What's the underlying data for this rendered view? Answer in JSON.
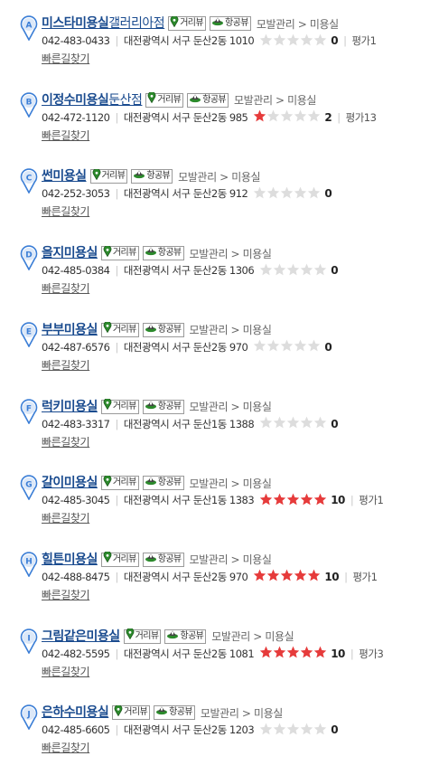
{
  "labels": {
    "street_view": "거리뷰",
    "aerial_view": "항공뷰",
    "category": "모발관리 > 미용실",
    "route": "빠른길찾기",
    "eval_prefix": "평가"
  },
  "colors": {
    "link": "#1a4b8f",
    "star_on": "#e63b3b",
    "star_off": "#dddddd",
    "marker": "#3b7ed6"
  },
  "results": [
    {
      "marker": "A",
      "name_bold": "미스타미용실",
      "name_rest": "갤러리아점",
      "phone": "042-483-0433",
      "address": "대전광역시 서구 둔산2동 1010",
      "rating_stars": 0,
      "score": "0",
      "eval": "1"
    },
    {
      "marker": "B",
      "name_bold": "이정수미용실",
      "name_rest": "둔산점",
      "phone": "042-472-1120",
      "address": "대전광역시 서구 둔산2동 985",
      "rating_stars": 1,
      "score": "2",
      "eval": "13"
    },
    {
      "marker": "C",
      "name_bold": "썬미용실",
      "name_rest": "",
      "phone": "042-252-3053",
      "address": "대전광역시 서구 둔산2동 912",
      "rating_stars": 0,
      "score": "0",
      "eval": ""
    },
    {
      "marker": "D",
      "name_bold": "을지미용실",
      "name_rest": "",
      "phone": "042-485-0384",
      "address": "대전광역시 서구 둔산2동 1306",
      "rating_stars": 0,
      "score": "0",
      "eval": ""
    },
    {
      "marker": "E",
      "name_bold": "부부미용실",
      "name_rest": "",
      "phone": "042-487-6576",
      "address": "대전광역시 서구 둔산2동 970",
      "rating_stars": 0,
      "score": "0",
      "eval": ""
    },
    {
      "marker": "F",
      "name_bold": "럭키미용실",
      "name_rest": "",
      "phone": "042-483-3317",
      "address": "대전광역시 서구 둔산1동 1388",
      "rating_stars": 0,
      "score": "0",
      "eval": ""
    },
    {
      "marker": "G",
      "name_bold": "갈이미용실",
      "name_rest": "",
      "phone": "042-485-3045",
      "address": "대전광역시 서구 둔산1동 1383",
      "rating_stars": 5,
      "score": "10",
      "eval": "1"
    },
    {
      "marker": "H",
      "name_bold": "힐튼미용실",
      "name_rest": "",
      "phone": "042-488-8475",
      "address": "대전광역시 서구 둔산2동 970",
      "rating_stars": 5,
      "score": "10",
      "eval": "1"
    },
    {
      "marker": "I",
      "name_bold": "그림같은미용실",
      "name_rest": "",
      "phone": "042-482-5595",
      "address": "대전광역시 서구 둔산2동 1081",
      "rating_stars": 5,
      "score": "10",
      "eval": "3"
    },
    {
      "marker": "J",
      "name_bold": "은하수미용실",
      "name_rest": "",
      "phone": "042-485-6605",
      "address": "대전광역시 서구 둔산2동 1203",
      "rating_stars": 0,
      "score": "0",
      "eval": ""
    }
  ]
}
